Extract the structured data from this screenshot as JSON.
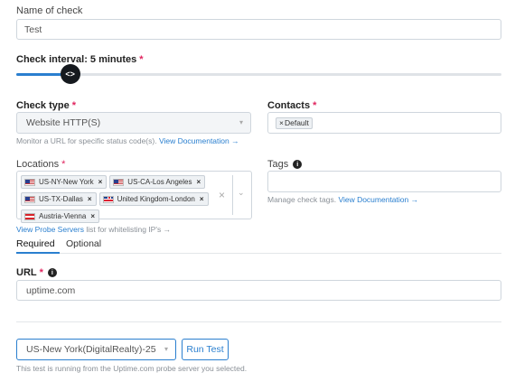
{
  "name_of_check": {
    "label": "Name of check",
    "value": "Test"
  },
  "interval": {
    "label": "Check interval: 5 minutes",
    "required": "*",
    "level_fraction": 0.07
  },
  "check_type": {
    "label": "Check type",
    "required": "*",
    "value": "Website HTTP(S)",
    "help_prefix": "Monitor a URL for specific status code(s). ",
    "help_link": "View Documentation →"
  },
  "contacts": {
    "label": "Contacts",
    "required": "*",
    "chip": "Default",
    "chip_x": "×"
  },
  "locations": {
    "label": "Locations",
    "required": "*",
    "items": [
      {
        "name": "US-NY-New York",
        "flag": "us"
      },
      {
        "name": "US-CA-Los Angeles",
        "flag": "us"
      },
      {
        "name": "US-TX-Dallas",
        "flag": "us"
      },
      {
        "name": "United Kingdom-London",
        "flag": "gb"
      },
      {
        "name": "Austria-Vienna",
        "flag": "at"
      }
    ],
    "remove_glyph": "×",
    "clear_glyph": "×",
    "help_link": "View Probe Servers",
    "help_suffix": " list for whitelisting IP's →"
  },
  "tags": {
    "label": "Tags",
    "help_prefix": "Manage check tags. ",
    "help_link": "View Documentation →"
  },
  "tabs": [
    {
      "label": "Required"
    },
    {
      "label": "Optional"
    }
  ],
  "url": {
    "label": "URL",
    "required": "*",
    "value": "uptime.com"
  },
  "probe": {
    "value": "US-New York(DigitalRealty)-25",
    "run_label": "Run Test",
    "note": "This test is running from the Uptime.com probe server you selected."
  },
  "colors": {
    "accent": "#2a7fcf",
    "required": "#e0245e"
  }
}
